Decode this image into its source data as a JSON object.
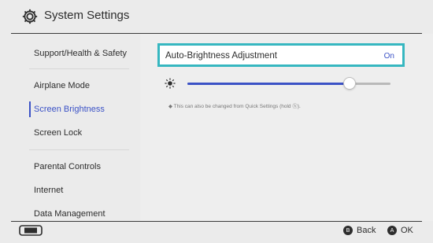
{
  "header": {
    "title": "System Settings"
  },
  "sidebar": {
    "items": [
      {
        "label": "Support/Health & Safety"
      },
      {
        "label": "Airplane Mode"
      },
      {
        "label": "Screen Brightness"
      },
      {
        "label": "Screen Lock"
      },
      {
        "label": "Parental Controls"
      },
      {
        "label": "Internet"
      },
      {
        "label": "Data Management"
      }
    ],
    "selected_index": 2
  },
  "content": {
    "auto_brightness": {
      "label": "Auto-Brightness Adjustment",
      "value": "On"
    },
    "brightness_slider": {
      "level": 0.8
    },
    "note": "◆ This can also be changed from Quick Settings (hold ⓗ)."
  },
  "footer": {
    "back": {
      "button": "B",
      "label": "Back"
    },
    "ok": {
      "button": "A",
      "label": "OK"
    }
  },
  "colors": {
    "accent": "#3b52c6",
    "highlight_border": "#36b7c0",
    "background": "#ebebeb"
  },
  "icons": [
    "gear-icon",
    "sun-icon",
    "handheld-console-icon"
  ]
}
